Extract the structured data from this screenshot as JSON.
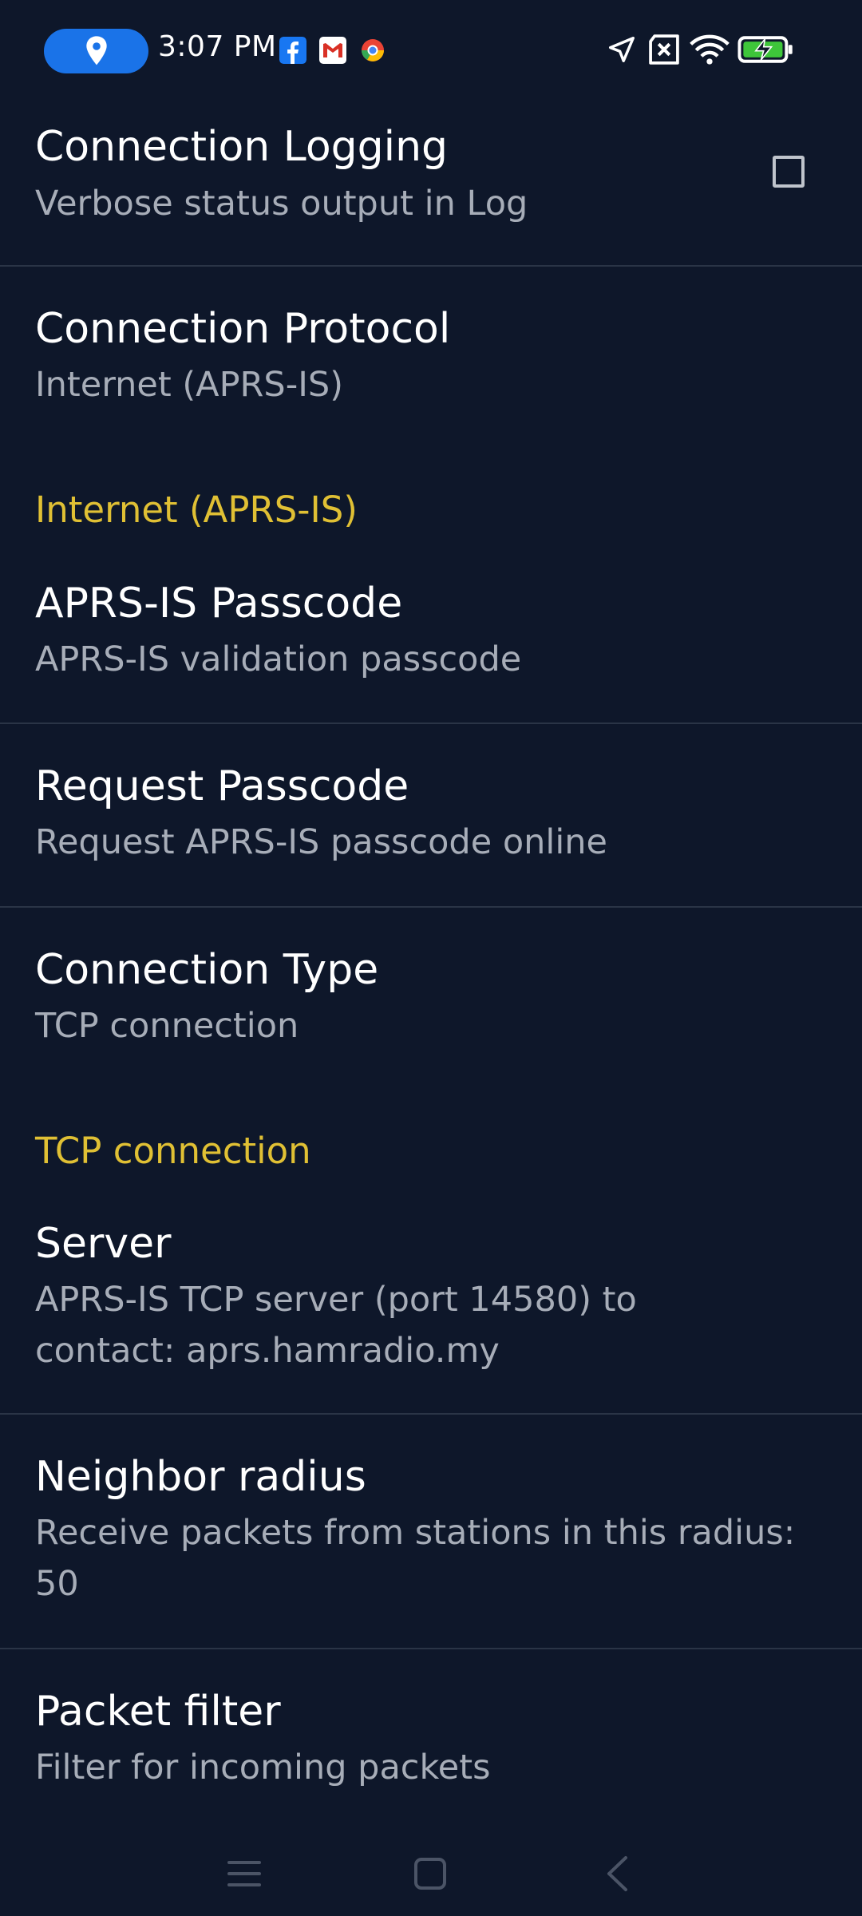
{
  "status_bar": {
    "time": "3:07 PM",
    "icons": [
      "location-pin-icon",
      "facebook-icon",
      "gmail-icon",
      "chrome-icon",
      "navigation-arrow-icon",
      "no-sim-icon",
      "wifi-icon",
      "battery-charging-icon"
    ]
  },
  "prefs": {
    "connection_logging": {
      "title": "Connection Logging",
      "summary": "Verbose status output in Log",
      "checked": false
    },
    "connection_protocol": {
      "title": "Connection Protocol",
      "summary": "Internet (APRS-IS)"
    },
    "category_internet": "Internet (APRS-IS)",
    "passcode": {
      "title": "APRS-IS Passcode",
      "summary": "APRS-IS validation passcode"
    },
    "request_passcode": {
      "title": "Request Passcode",
      "summary": "Request APRS-IS passcode online"
    },
    "connection_type": {
      "title": "Connection Type",
      "summary": "TCP connection"
    },
    "category_tcp": "TCP connection",
    "server": {
      "title": "Server",
      "summary": "APRS-IS TCP server (port 14580) to contact: aprs.hamradio.my"
    },
    "neighbor_radius": {
      "title": "Neighbor radius",
      "summary": "Receive packets from stations in this radius: 50"
    },
    "packet_filter": {
      "title": "Packet filter",
      "summary": "Filter for incoming packets"
    }
  },
  "nav_bar": {
    "icons": [
      "menu-icon",
      "home-icon",
      "back-icon"
    ]
  },
  "colors": {
    "background": "#0e172a",
    "category": "#e0c034",
    "summary": "#a7adb8",
    "divider": "#2a3446"
  }
}
